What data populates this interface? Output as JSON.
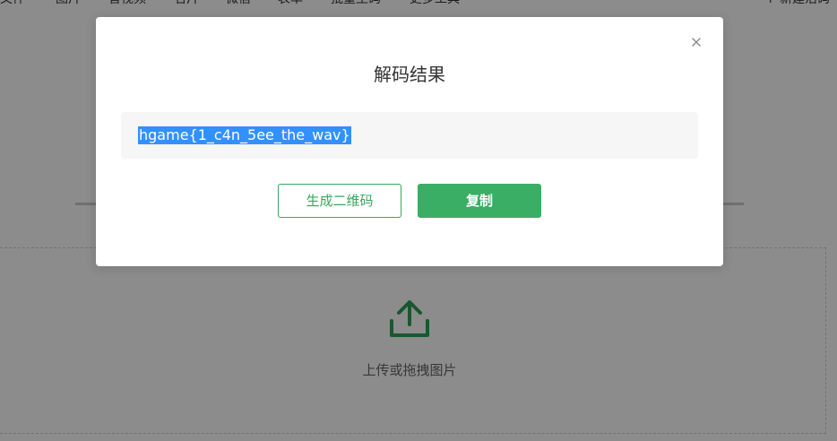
{
  "colors": {
    "accent": "#3aae64",
    "selection": "#3390ff",
    "mask": "#000000"
  },
  "nav": {
    "items": [
      "文件",
      "图片",
      "音视频",
      "名片",
      "微信",
      "表单",
      "批量生码",
      "更多工具"
    ],
    "right": "+ 新建活码"
  },
  "upload": {
    "icon": "upload-icon",
    "text": "上传或拖拽图片"
  },
  "modal": {
    "title": "解码结果",
    "result": "hgame{1_c4n_5ee_the_wav}",
    "close_icon": "close-icon",
    "generate_label": "生成二维码",
    "copy_label": "复制"
  }
}
